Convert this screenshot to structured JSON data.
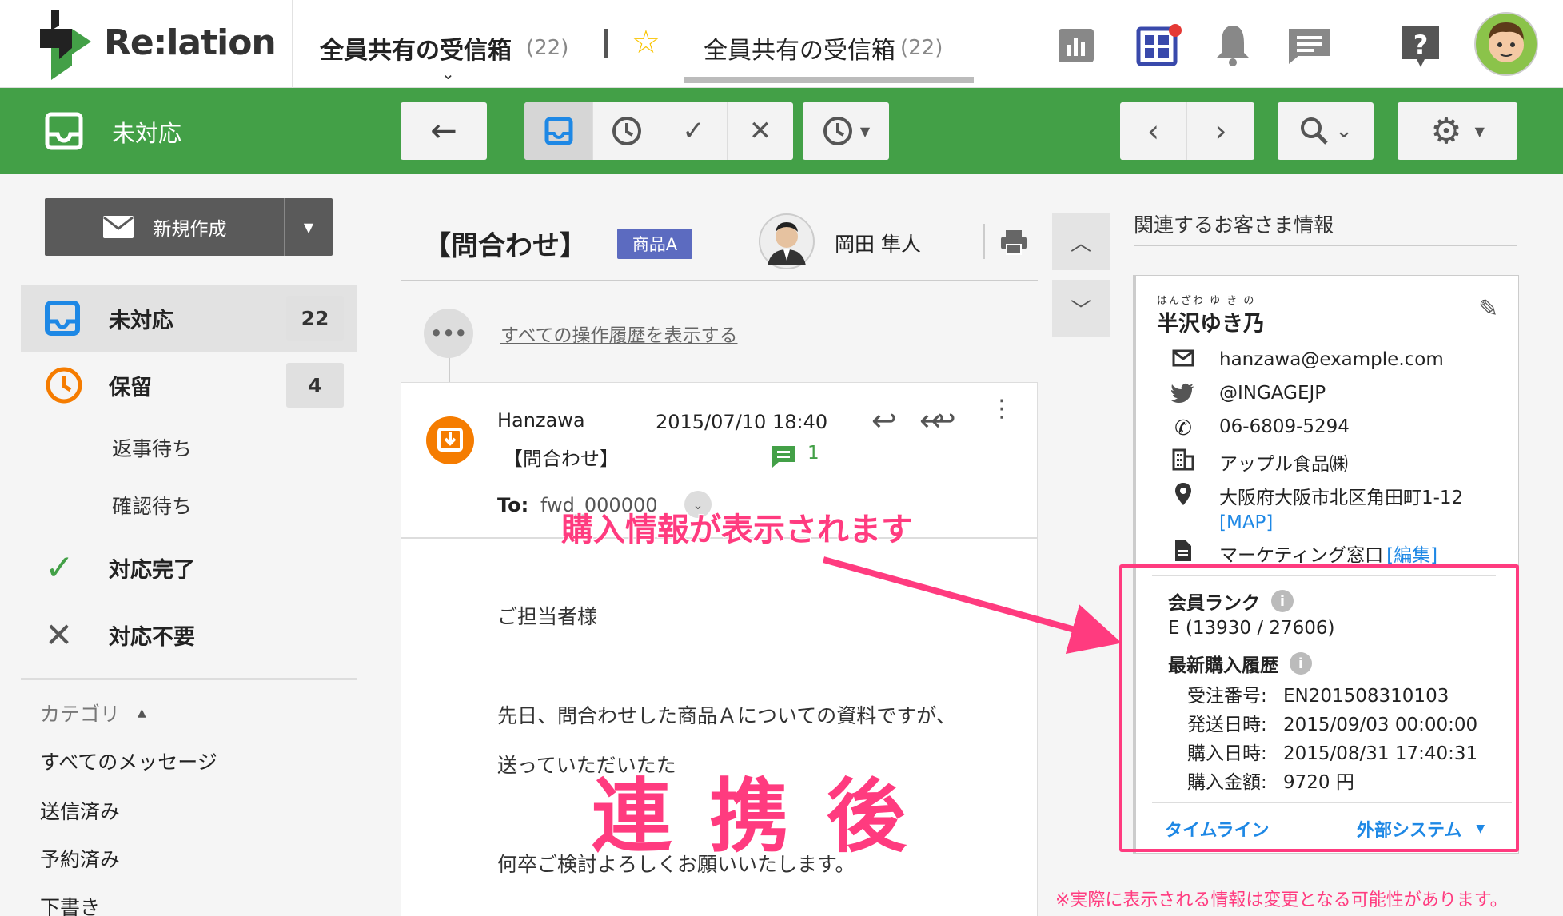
{
  "app": {
    "logo_text": "Re:lation"
  },
  "header": {
    "mailbox_name": "全員共有の受信箱",
    "mailbox_count": "(22)",
    "tab_name": "全員共有の受信箱",
    "tab_count": "(22)"
  },
  "toolbar": {
    "status_label": "未対応"
  },
  "sidebar": {
    "compose_label": "新規作成",
    "items": [
      {
        "label": "未対応",
        "count": "22"
      },
      {
        "label": "保留",
        "count": "4"
      },
      {
        "label": "返事待ち"
      },
      {
        "label": "確認待ち"
      },
      {
        "label": "対応完了"
      },
      {
        "label": "対応不要"
      }
    ],
    "category_header": "カテゴリ",
    "categories": [
      "すべてのメッセージ",
      "送信済み",
      "予約済み",
      "下書き"
    ]
  },
  "message": {
    "subject": "【問合わせ】",
    "tag": "商品A",
    "assignee": "岡田 隼人",
    "history_link": "すべての操作履歴を表示する",
    "from": "Hanzawa",
    "date": "2015/07/10 18:40",
    "preview_subject": "【問合わせ】",
    "comment_count": "1",
    "to_label": "To:",
    "to_value": "fwd_000000",
    "body": [
      "ご担当者様",
      "先日、問合わせした商品Ａについての資料ですが、",
      "送っていただいたた",
      "何卒ご検討よろしくお願いいたします。"
    ]
  },
  "customer": {
    "section_title": "関連するお客さま情報",
    "furigana": "はんざわ ゆ き の",
    "name": "半沢ゆき乃",
    "email": "hanzawa@example.com",
    "twitter": "@INGAGEJP",
    "phone": "06-6809-5294",
    "company": "アップル食品㈱",
    "address": "大阪府大阪市北区角田町1-12",
    "map_link": "[MAP]",
    "memo": "マーケティング窓口",
    "edit_link": "[編集]",
    "rank_label": "会員ランク",
    "rank_value": "E (13930 / 27606)",
    "purchase_label": "最新購入履歴",
    "order_no_label": "受注番号:",
    "order_no": "EN201508310103",
    "ship_label": "発送日時:",
    "ship_date": "2015/09/03 00:00:00",
    "buy_label": "購入日時:",
    "buy_date": "2015/08/31 17:40:31",
    "amount_label": "購入金額:",
    "amount": "9720 円",
    "timeline_tab": "タイムライン",
    "external_tab": "外部システム"
  },
  "annotations": {
    "callout": "購入情報が表示されます",
    "big_label": "連 携 後",
    "disclaimer": "※実際に表示される情報は変更となる可能性があります。"
  },
  "colors": {
    "green": "#43a047",
    "pink": "#ff3b7f",
    "link": "#1e88e5",
    "orange": "#f57c00"
  }
}
